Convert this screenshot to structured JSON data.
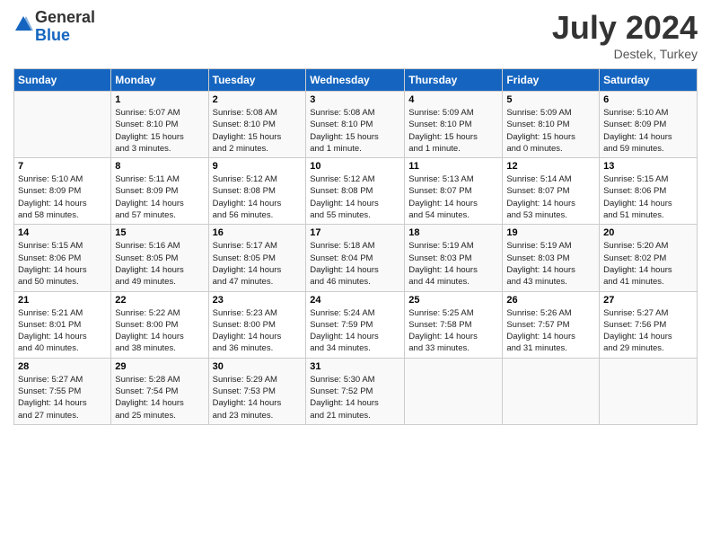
{
  "header": {
    "logo_general": "General",
    "logo_blue": "Blue",
    "month": "July 2024",
    "location": "Destek, Turkey"
  },
  "days_of_week": [
    "Sunday",
    "Monday",
    "Tuesday",
    "Wednesday",
    "Thursday",
    "Friday",
    "Saturday"
  ],
  "weeks": [
    [
      {
        "day": "",
        "info": ""
      },
      {
        "day": "1",
        "info": "Sunrise: 5:07 AM\nSunset: 8:10 PM\nDaylight: 15 hours\nand 3 minutes."
      },
      {
        "day": "2",
        "info": "Sunrise: 5:08 AM\nSunset: 8:10 PM\nDaylight: 15 hours\nand 2 minutes."
      },
      {
        "day": "3",
        "info": "Sunrise: 5:08 AM\nSunset: 8:10 PM\nDaylight: 15 hours\nand 1 minute."
      },
      {
        "day": "4",
        "info": "Sunrise: 5:09 AM\nSunset: 8:10 PM\nDaylight: 15 hours\nand 1 minute."
      },
      {
        "day": "5",
        "info": "Sunrise: 5:09 AM\nSunset: 8:10 PM\nDaylight: 15 hours\nand 0 minutes."
      },
      {
        "day": "6",
        "info": "Sunrise: 5:10 AM\nSunset: 8:09 PM\nDaylight: 14 hours\nand 59 minutes."
      }
    ],
    [
      {
        "day": "7",
        "info": "Sunrise: 5:10 AM\nSunset: 8:09 PM\nDaylight: 14 hours\nand 58 minutes."
      },
      {
        "day": "8",
        "info": "Sunrise: 5:11 AM\nSunset: 8:09 PM\nDaylight: 14 hours\nand 57 minutes."
      },
      {
        "day": "9",
        "info": "Sunrise: 5:12 AM\nSunset: 8:08 PM\nDaylight: 14 hours\nand 56 minutes."
      },
      {
        "day": "10",
        "info": "Sunrise: 5:12 AM\nSunset: 8:08 PM\nDaylight: 14 hours\nand 55 minutes."
      },
      {
        "day": "11",
        "info": "Sunrise: 5:13 AM\nSunset: 8:07 PM\nDaylight: 14 hours\nand 54 minutes."
      },
      {
        "day": "12",
        "info": "Sunrise: 5:14 AM\nSunset: 8:07 PM\nDaylight: 14 hours\nand 53 minutes."
      },
      {
        "day": "13",
        "info": "Sunrise: 5:15 AM\nSunset: 8:06 PM\nDaylight: 14 hours\nand 51 minutes."
      }
    ],
    [
      {
        "day": "14",
        "info": "Sunrise: 5:15 AM\nSunset: 8:06 PM\nDaylight: 14 hours\nand 50 minutes."
      },
      {
        "day": "15",
        "info": "Sunrise: 5:16 AM\nSunset: 8:05 PM\nDaylight: 14 hours\nand 49 minutes."
      },
      {
        "day": "16",
        "info": "Sunrise: 5:17 AM\nSunset: 8:05 PM\nDaylight: 14 hours\nand 47 minutes."
      },
      {
        "day": "17",
        "info": "Sunrise: 5:18 AM\nSunset: 8:04 PM\nDaylight: 14 hours\nand 46 minutes."
      },
      {
        "day": "18",
        "info": "Sunrise: 5:19 AM\nSunset: 8:03 PM\nDaylight: 14 hours\nand 44 minutes."
      },
      {
        "day": "19",
        "info": "Sunrise: 5:19 AM\nSunset: 8:03 PM\nDaylight: 14 hours\nand 43 minutes."
      },
      {
        "day": "20",
        "info": "Sunrise: 5:20 AM\nSunset: 8:02 PM\nDaylight: 14 hours\nand 41 minutes."
      }
    ],
    [
      {
        "day": "21",
        "info": "Sunrise: 5:21 AM\nSunset: 8:01 PM\nDaylight: 14 hours\nand 40 minutes."
      },
      {
        "day": "22",
        "info": "Sunrise: 5:22 AM\nSunset: 8:00 PM\nDaylight: 14 hours\nand 38 minutes."
      },
      {
        "day": "23",
        "info": "Sunrise: 5:23 AM\nSunset: 8:00 PM\nDaylight: 14 hours\nand 36 minutes."
      },
      {
        "day": "24",
        "info": "Sunrise: 5:24 AM\nSunset: 7:59 PM\nDaylight: 14 hours\nand 34 minutes."
      },
      {
        "day": "25",
        "info": "Sunrise: 5:25 AM\nSunset: 7:58 PM\nDaylight: 14 hours\nand 33 minutes."
      },
      {
        "day": "26",
        "info": "Sunrise: 5:26 AM\nSunset: 7:57 PM\nDaylight: 14 hours\nand 31 minutes."
      },
      {
        "day": "27",
        "info": "Sunrise: 5:27 AM\nSunset: 7:56 PM\nDaylight: 14 hours\nand 29 minutes."
      }
    ],
    [
      {
        "day": "28",
        "info": "Sunrise: 5:27 AM\nSunset: 7:55 PM\nDaylight: 14 hours\nand 27 minutes."
      },
      {
        "day": "29",
        "info": "Sunrise: 5:28 AM\nSunset: 7:54 PM\nDaylight: 14 hours\nand 25 minutes."
      },
      {
        "day": "30",
        "info": "Sunrise: 5:29 AM\nSunset: 7:53 PM\nDaylight: 14 hours\nand 23 minutes."
      },
      {
        "day": "31",
        "info": "Sunrise: 5:30 AM\nSunset: 7:52 PM\nDaylight: 14 hours\nand 21 minutes."
      },
      {
        "day": "",
        "info": ""
      },
      {
        "day": "",
        "info": ""
      },
      {
        "day": "",
        "info": ""
      }
    ]
  ]
}
